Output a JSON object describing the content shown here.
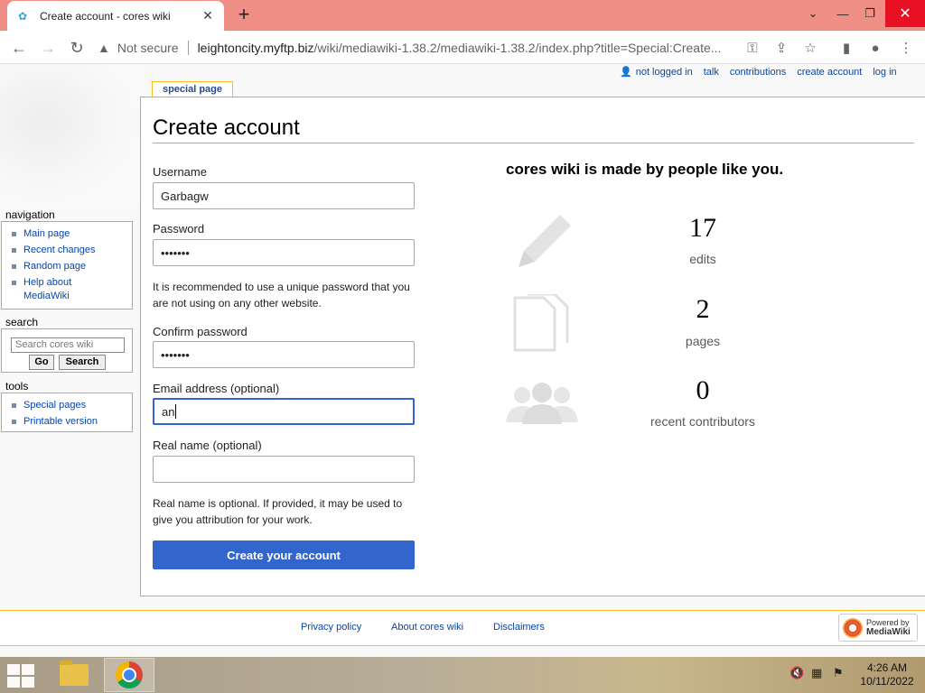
{
  "browser": {
    "tab_title": "Create account - cores wiki",
    "tab_close": "✕",
    "new_tab": "+",
    "not_secure": "Not secure",
    "url_host": "leightoncity.myftp.biz",
    "url_path": "/wiki/mediawiki-1.38.2/mediawiki-1.38.2/index.php?title=Special:Create..."
  },
  "personal_tools": {
    "not_logged_in": "not logged in",
    "talk": "talk",
    "contributions": "contributions",
    "create_account": "create account",
    "log_in": "log in"
  },
  "page_tab": "special page",
  "page_title": "Create account",
  "form": {
    "username_label": "Username",
    "username_value": "Garbagw",
    "password_label": "Password",
    "password_value": "•••••••",
    "password_help": "It is recommended to use a unique password that you are not using on any other website.",
    "confirm_label": "Confirm password",
    "confirm_value": "•••••••",
    "email_label": "Email address (optional)",
    "email_value": "an",
    "realname_label": "Real name (optional)",
    "realname_value": "",
    "realname_help": "Real name is optional. If provided, it may be used to give you attribution for your work.",
    "submit_label": "Create your account"
  },
  "promo": {
    "title": "cores wiki is made by people like you.",
    "stats": [
      {
        "value": "17",
        "label": "edits",
        "icon": "pencil-icon"
      },
      {
        "value": "2",
        "label": "pages",
        "icon": "pages-icon"
      },
      {
        "value": "0",
        "label": "recent contributors",
        "icon": "people-icon"
      }
    ]
  },
  "sidebar": {
    "navigation_heading": "navigation",
    "navigation": [
      "Main page",
      "Recent changes",
      "Random page"
    ],
    "help_line1": "Help about",
    "help_line2": "MediaWiki",
    "search_heading": "search",
    "search_placeholder": "Search cores wiki",
    "go_label": "Go",
    "search_label": "Search",
    "tools_heading": "tools",
    "tools": [
      "Special pages",
      "Printable version"
    ]
  },
  "footer": {
    "privacy": "Privacy policy",
    "about": "About cores wiki",
    "disclaimers": "Disclaimers",
    "powered_line1": "Powered by",
    "powered_line2": "MediaWiki"
  },
  "taskbar": {
    "time": "4:26 AM",
    "date": "10/11/2022"
  },
  "colors": {
    "titlebar": "#f08f86",
    "accent": "#3366cc",
    "link": "#0645ad"
  }
}
